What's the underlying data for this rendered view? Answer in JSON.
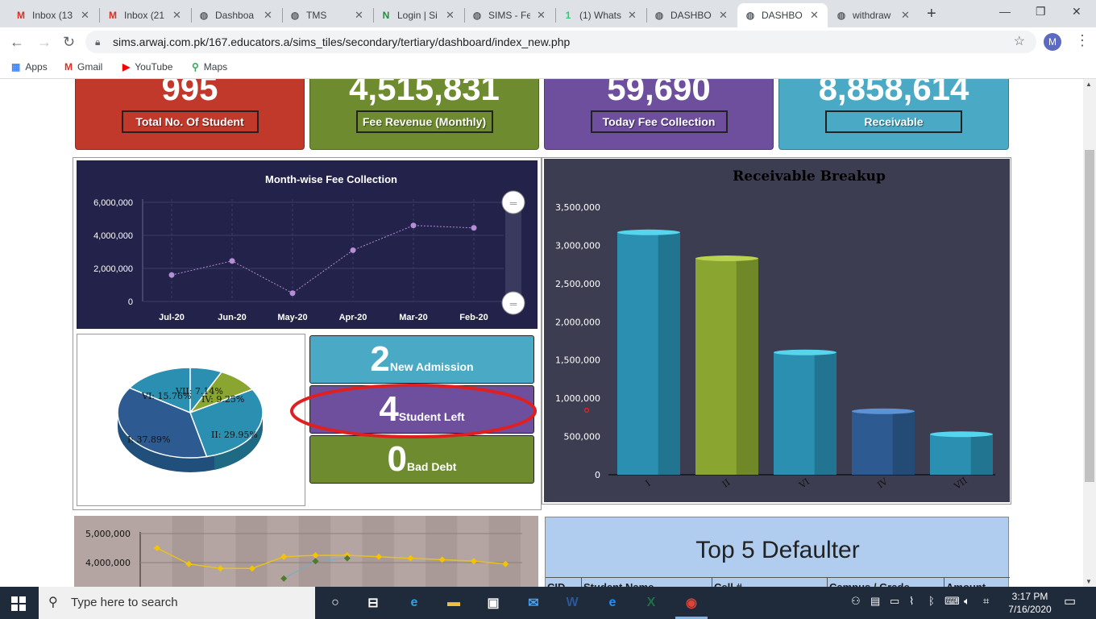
{
  "browser": {
    "tabs": [
      {
        "title": "Inbox (13",
        "icon": "gmail-icon",
        "glyph": "M",
        "color": "#d93025"
      },
      {
        "title": "Inbox (21",
        "icon": "gmail-icon",
        "glyph": "M",
        "color": "#d93025"
      },
      {
        "title": "Dashboa",
        "icon": "globe-icon",
        "glyph": "◍",
        "color": "#5f6368"
      },
      {
        "title": "TMS",
        "icon": "globe-icon",
        "glyph": "◍",
        "color": "#5f6368"
      },
      {
        "title": "Login | Si",
        "icon": "nexus-icon",
        "glyph": "N",
        "color": "#1e8e3e"
      },
      {
        "title": "SIMS - Fe",
        "icon": "globe-icon",
        "glyph": "◍",
        "color": "#5f6368"
      },
      {
        "title": "(1) Whats",
        "icon": "whatsapp-icon",
        "glyph": "1",
        "color": "#25d366"
      },
      {
        "title": "DASHBO",
        "icon": "globe-icon",
        "glyph": "◍",
        "color": "#5f6368"
      },
      {
        "title": "DASHBO",
        "icon": "globe-icon",
        "glyph": "◍",
        "color": "#5f6368"
      },
      {
        "title": "withdraw",
        "icon": "globe-icon",
        "glyph": "◍",
        "color": "#5f6368"
      }
    ],
    "url": "sims.arwaj.com.pk/167.educators.a/sims_tiles/secondary/tertiary/dashboard/index_new.php",
    "avatar_letter": "M",
    "bookmarks": [
      {
        "label": "Apps",
        "icon": "apps-grid-icon",
        "glyph": "▦",
        "color": "#4285f4"
      },
      {
        "label": "Gmail",
        "icon": "gmail-icon",
        "glyph": "M",
        "color": "#d93025"
      },
      {
        "label": "YouTube",
        "icon": "youtube-icon",
        "glyph": "▶",
        "color": "#ff0000"
      },
      {
        "label": "Maps",
        "icon": "maps-pin-icon",
        "glyph": "⚲",
        "color": "#34a853"
      }
    ]
  },
  "kpis": [
    {
      "value": "995",
      "label": "Total No. Of Student",
      "color": "#c0392b"
    },
    {
      "value": "4,515,831",
      "label": "Fee Revenue (Monthly)",
      "color": "#6e8c2f"
    },
    {
      "value": "59,690",
      "label": "Today Fee Collection",
      "color": "#6e4f9e"
    },
    {
      "value": "8,858,614",
      "label": "Receivable",
      "color": "#4aa9c4"
    }
  ],
  "line_chart": {
    "chart_data": {
      "type": "line",
      "title": "Month-wise Fee Collection",
      "categories": [
        "Jul-20",
        "Jun-20",
        "May-20",
        "Apr-20",
        "Mar-20",
        "Feb-20"
      ],
      "values": [
        1600000,
        2450000,
        500000,
        3100000,
        4600000,
        4450000
      ],
      "yticks": [
        "6,000,000",
        "4,000,000",
        "2,000,000",
        "0"
      ],
      "ylim": [
        0,
        6000000
      ]
    }
  },
  "pie_chart": {
    "chart_data": {
      "type": "pie",
      "slices": [
        {
          "label": "VI: 15.76%",
          "value": 15.76
        },
        {
          "label": "VII: 7.14%",
          "value": 7.14
        },
        {
          "label": "IV: 9.25%",
          "value": 9.25
        },
        {
          "label": "II: 29.95%",
          "value": 29.95
        },
        {
          "label": "I: 37.89%",
          "value": 37.89
        }
      ]
    }
  },
  "stats": [
    {
      "number": "2",
      "label": "New Admission",
      "color": "#4aa9c4"
    },
    {
      "number": "4",
      "label": "Student Left",
      "color": "#6e4f9e"
    },
    {
      "number": "0",
      "label": "Bad Debt",
      "color": "#6e8c2f"
    }
  ],
  "bar_chart": {
    "chart_data": {
      "type": "bar",
      "title": "Receivable Breakup",
      "categories": [
        "I",
        "II",
        "VI",
        "IV",
        "VII"
      ],
      "values": [
        3170000,
        2830000,
        1600000,
        830000,
        530000
      ],
      "colors": [
        "#2a8fb0",
        "#8aa631",
        "#2a8fb0",
        "#2d5b91",
        "#2a8fb0"
      ],
      "yticks": [
        "3,500,000",
        "3,000,000",
        "2,500,000",
        "2,000,000",
        "1,500,000",
        "1,000,000",
        "500,000",
        "0"
      ],
      "ylim": [
        0,
        3500000
      ]
    }
  },
  "bottom_chart": {
    "chart_data": {
      "type": "line",
      "yticks": [
        "5,000,000",
        "4,000,000"
      ],
      "series": [
        {
          "values": [
            4500000,
            3950000,
            3800000,
            3800000,
            4200000,
            4250000,
            4250000,
            4200000,
            4150000,
            4100000,
            4050000,
            3950000
          ]
        },
        {
          "values": [
            null,
            null,
            null,
            null,
            3450000,
            4050000,
            4150000,
            null,
            null,
            null,
            null,
            null
          ]
        }
      ]
    }
  },
  "defaulter": {
    "title": "Top 5 Defaulter",
    "columns": [
      "CID",
      "Student Name",
      "Cell #",
      "Campus / Grade",
      "Amount"
    ]
  },
  "taskbar": {
    "search_placeholder": "Type here to search",
    "time": "3:17 PM",
    "date": "7/16/2020",
    "apps": [
      {
        "icon": "task-view-icon",
        "glyph": "○"
      },
      {
        "icon": "timeline-icon",
        "glyph": "⊟"
      },
      {
        "icon": "edge-icon",
        "glyph": "e"
      },
      {
        "icon": "file-explorer-icon",
        "glyph": "▬"
      },
      {
        "icon": "store-icon",
        "glyph": "▣"
      },
      {
        "icon": "mail-icon",
        "glyph": "✉"
      },
      {
        "icon": "word-icon",
        "glyph": "W"
      },
      {
        "icon": "ie-icon",
        "glyph": "e"
      },
      {
        "icon": "excel-icon",
        "glyph": "X"
      },
      {
        "icon": "chrome-icon",
        "glyph": "◉"
      }
    ]
  }
}
